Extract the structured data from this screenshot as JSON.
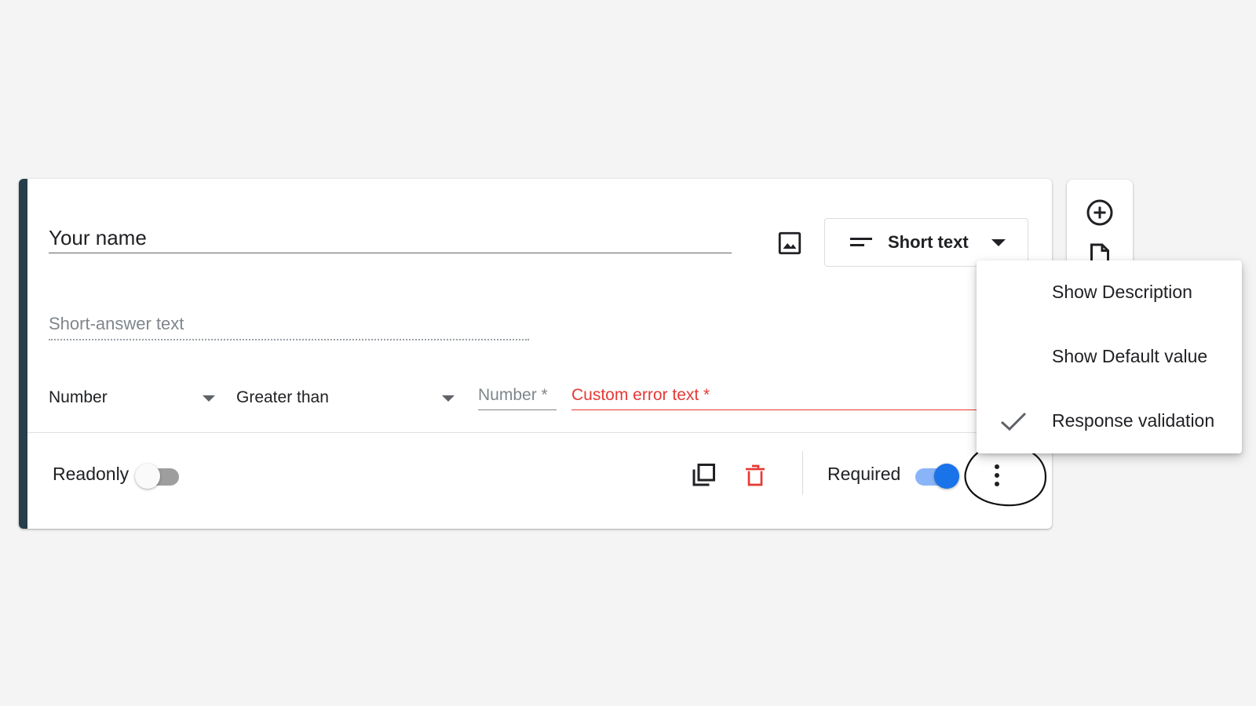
{
  "colors": {
    "accent": "#263f4a",
    "primary": "#1a73e8",
    "error": "#e53935",
    "annotation": "#111111"
  },
  "question": {
    "title": "Your name",
    "type_label": "Short text",
    "type_icon": "short-text-icon",
    "image_icon": "image-icon",
    "answer_placeholder": "Short-answer text"
  },
  "validation": {
    "type": "Number",
    "operator": "Greater than",
    "number_placeholder": "Number *",
    "error_placeholder": "Custom error text *"
  },
  "footer": {
    "readonly_label": "Readonly",
    "readonly_on": false,
    "duplicate_icon": "copy-icon",
    "delete_icon": "trash-icon",
    "required_label": "Required",
    "required_on": true,
    "more_icon": "more-vert-icon"
  },
  "side_toolbar": {
    "icons": [
      "add-circle-icon",
      "import-document-icon"
    ]
  },
  "menu": {
    "items": [
      {
        "label": "Show Description",
        "checked": false
      },
      {
        "label": "Show Default value",
        "checked": false
      },
      {
        "label": "Response validation",
        "checked": true
      }
    ]
  }
}
